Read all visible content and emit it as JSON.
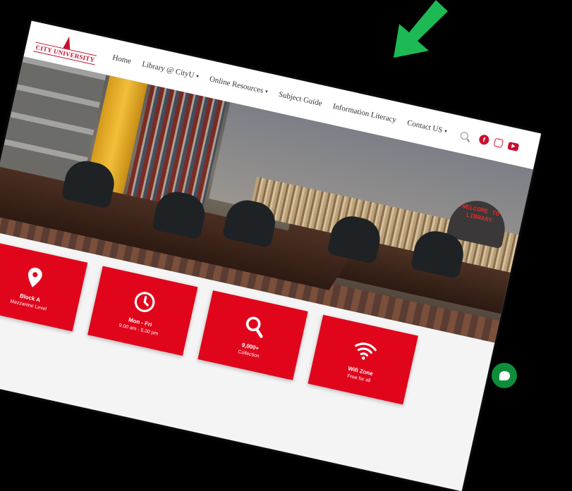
{
  "logo": {
    "text": "CITY UNIVERSITY"
  },
  "nav": {
    "items": [
      {
        "label": "Home",
        "dropdown": false
      },
      {
        "label": "Library @ CityU",
        "dropdown": true
      },
      {
        "label": "Online Resources",
        "dropdown": true
      },
      {
        "label": "Subject Guide",
        "dropdown": false
      },
      {
        "label": "Information Literacy",
        "dropdown": false
      },
      {
        "label": "Contact US",
        "dropdown": true
      }
    ],
    "caret": "▾",
    "icons": [
      "search-icon",
      "facebook-icon",
      "instagram-icon",
      "youtube-icon"
    ],
    "facebook_glyph": "f"
  },
  "hero": {
    "sign_text": "WELCOME TO LIBRARY"
  },
  "cards": [
    {
      "icon": "map-pin-icon",
      "title": "Block A",
      "subtitle": "Mezzanine Level"
    },
    {
      "icon": "clock-icon",
      "title": "Mon - Fri",
      "subtitle": "9.00 am - 5.00 pm"
    },
    {
      "icon": "search-icon",
      "title": "9,000+",
      "subtitle": "Collection"
    },
    {
      "icon": "wifi-icon",
      "title": "Wifi Zone",
      "subtitle": "Free for all"
    }
  ],
  "colors": {
    "brand_red": "#e1051c",
    "logo_red": "#c8102e",
    "arrow_green": "#1db954",
    "chat_green": "#0f8e3a"
  }
}
